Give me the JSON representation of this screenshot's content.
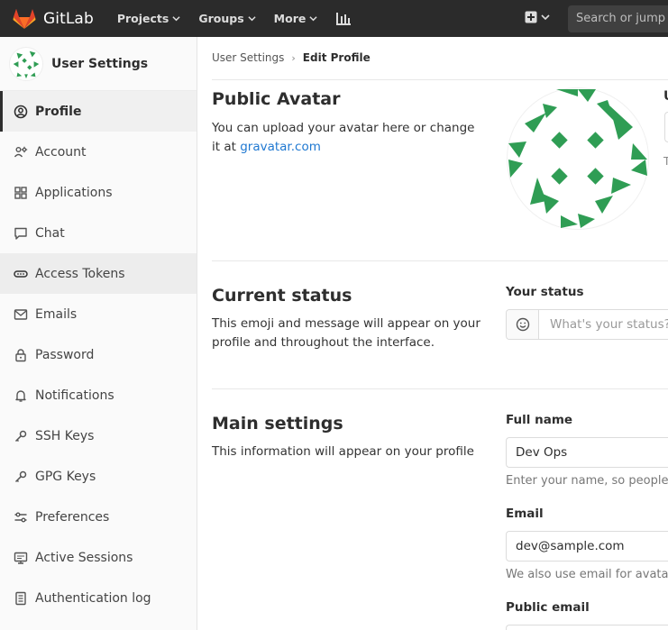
{
  "topbar": {
    "brand": "GitLab",
    "nav": [
      "Projects",
      "Groups",
      "More"
    ],
    "search_placeholder": "Search or jump to…"
  },
  "sidebar": {
    "title": "User Settings",
    "items": [
      {
        "label": "Profile",
        "icon": "profile-icon"
      },
      {
        "label": "Account",
        "icon": "account-icon"
      },
      {
        "label": "Applications",
        "icon": "applications-icon"
      },
      {
        "label": "Chat",
        "icon": "chat-icon"
      },
      {
        "label": "Access Tokens",
        "icon": "token-icon"
      },
      {
        "label": "Emails",
        "icon": "email-icon"
      },
      {
        "label": "Password",
        "icon": "lock-icon"
      },
      {
        "label": "Notifications",
        "icon": "bell-icon"
      },
      {
        "label": "SSH Keys",
        "icon": "key-icon"
      },
      {
        "label": "GPG Keys",
        "icon": "key-icon"
      },
      {
        "label": "Preferences",
        "icon": "preferences-icon"
      },
      {
        "label": "Active Sessions",
        "icon": "monitor-icon"
      },
      {
        "label": "Authentication log",
        "icon": "log-icon"
      }
    ]
  },
  "breadcrumb": {
    "parent": "User Settings",
    "separator": "›",
    "current": "Edit Profile"
  },
  "avatar_section": {
    "title": "Public Avatar",
    "desc_prefix": "You can upload your avatar here or change it at ",
    "link": "gravatar.com",
    "cut_label": "U",
    "cut_help": "T"
  },
  "status_section": {
    "title": "Current status",
    "desc": "This emoji and message will appear on your profile and throughout the interface.",
    "field_label": "Your status",
    "placeholder": "What's your status?"
  },
  "main_section": {
    "title": "Main settings",
    "desc": "This information will appear on your profile",
    "full_name_label": "Full name",
    "full_name_value": "Dev Ops",
    "full_name_help": "Enter your name, so people you know can recognize you",
    "email_label": "Email",
    "email_value": "dev@sample.com",
    "email_help": "We also use email for avatar detection if no avatar is uploaded",
    "public_email_label": "Public email"
  },
  "colors": {
    "topbar": "#2b2b2b",
    "brand_orange": "#e24329",
    "identicon_green": "#2f9d54",
    "link": "#1f78d1"
  }
}
